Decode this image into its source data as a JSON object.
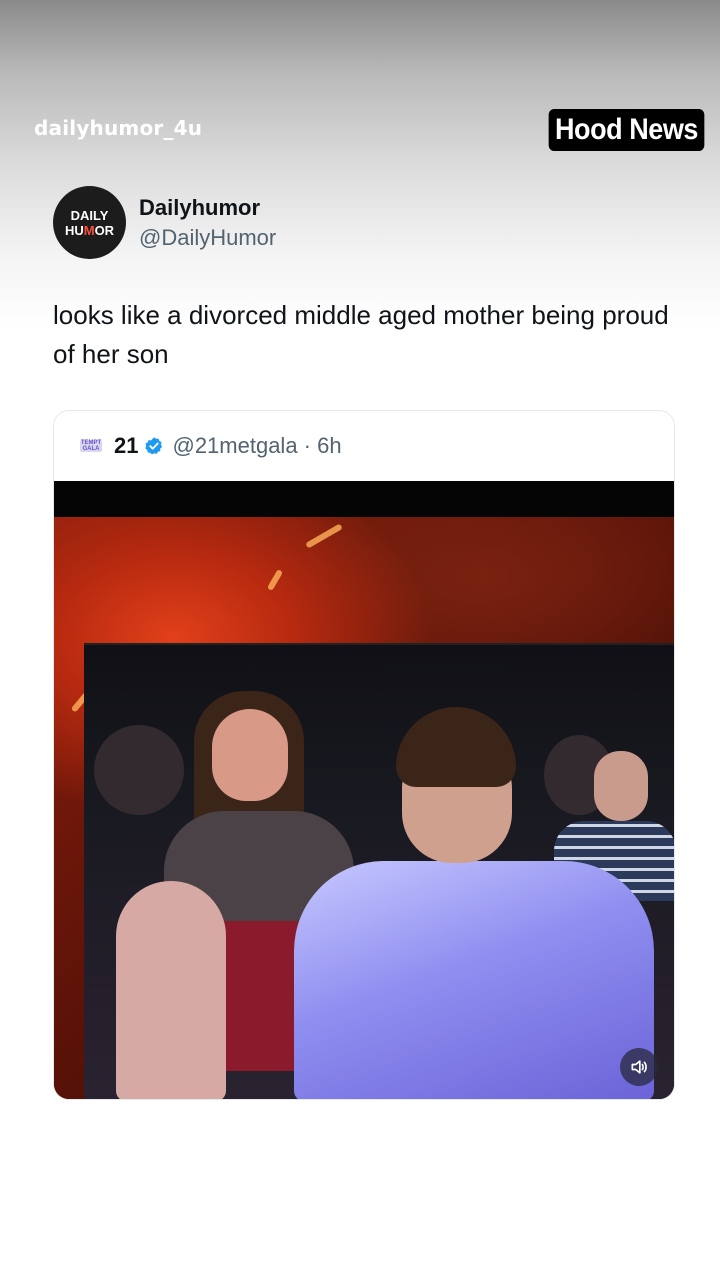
{
  "overlay": {
    "watermark": "dailyhumor_4u",
    "badge": "Hood News"
  },
  "post": {
    "avatar": {
      "line1": "DAILY",
      "line2_a": "HU",
      "line2_b": "M",
      "line2_c": "OR"
    },
    "display_name": "Dailyhumor",
    "handle": "@DailyHumor",
    "text": "looks like a divorced middle aged mother being proud of her son"
  },
  "quote": {
    "logo_text": "TEMPT GALA",
    "name": "21",
    "handle_time": "@21metgala · 6h",
    "verified": true,
    "media": {
      "type": "video",
      "sound_icon": "volume-icon"
    }
  },
  "colors": {
    "accent_verified": "#1d9bf0",
    "badge_bg": "#000000",
    "handle_gray": "#536471"
  }
}
